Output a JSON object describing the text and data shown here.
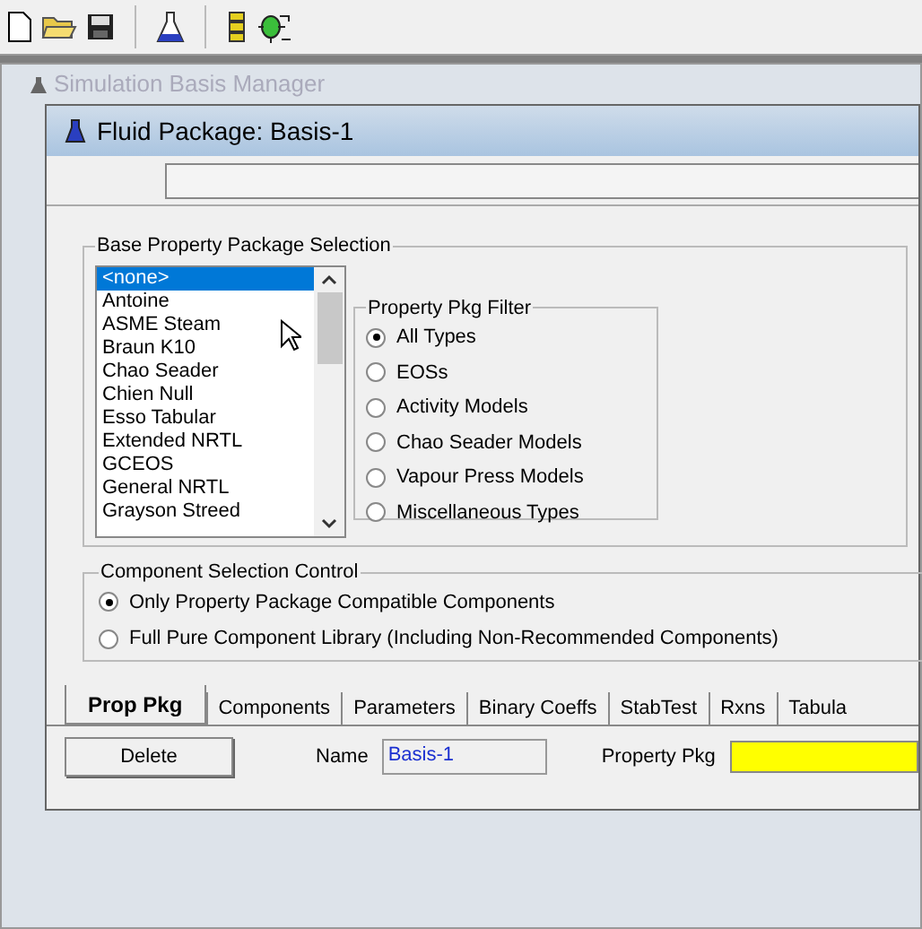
{
  "outer_window": {
    "title": "Simulation Basis Manager"
  },
  "window": {
    "title": "Fluid Package: Basis-1"
  },
  "base_property_package_selection": {
    "title": "Base Property Package Selection",
    "packages": [
      {
        "label": "<none>",
        "selected": true
      },
      {
        "label": "Antoine",
        "selected": false
      },
      {
        "label": "ASME Steam",
        "selected": false
      },
      {
        "label": "Braun K10",
        "selected": false
      },
      {
        "label": "Chao Seader",
        "selected": false
      },
      {
        "label": "Chien Null",
        "selected": false
      },
      {
        "label": "Esso Tabular",
        "selected": false
      },
      {
        "label": "Extended NRTL",
        "selected": false
      },
      {
        "label": "GCEOS",
        "selected": false
      },
      {
        "label": "General NRTL",
        "selected": false
      },
      {
        "label": "Grayson Streed",
        "selected": false
      }
    ],
    "filter": {
      "title": "Property Pkg Filter",
      "options": [
        {
          "label": "All Types",
          "selected": true
        },
        {
          "label": "EOSs",
          "selected": false
        },
        {
          "label": "Activity Models",
          "selected": false
        },
        {
          "label": "Chao Seader Models",
          "selected": false
        },
        {
          "label": "Vapour Press Models",
          "selected": false
        },
        {
          "label": "Miscellaneous Types",
          "selected": false
        }
      ]
    }
  },
  "component_selection_control": {
    "title": "Component Selection Control",
    "options": [
      {
        "label": "Only Property Package Compatible Components",
        "selected": true
      },
      {
        "label": "Full Pure Component Library (Including Non-Recommended Components)",
        "selected": false
      }
    ]
  },
  "tabs": [
    {
      "label": "Prop Pkg",
      "selected": true
    },
    {
      "label": "Components",
      "selected": false
    },
    {
      "label": "Parameters",
      "selected": false
    },
    {
      "label": "Binary Coeffs",
      "selected": false
    },
    {
      "label": "StabTest",
      "selected": false
    },
    {
      "label": "Rxns",
      "selected": false
    },
    {
      "label": "Tabula",
      "selected": false
    }
  ],
  "footer": {
    "delete_button": "Delete",
    "name_label": "Name",
    "name_value": "Basis-1",
    "property_pkg_label": "Property Pkg"
  }
}
